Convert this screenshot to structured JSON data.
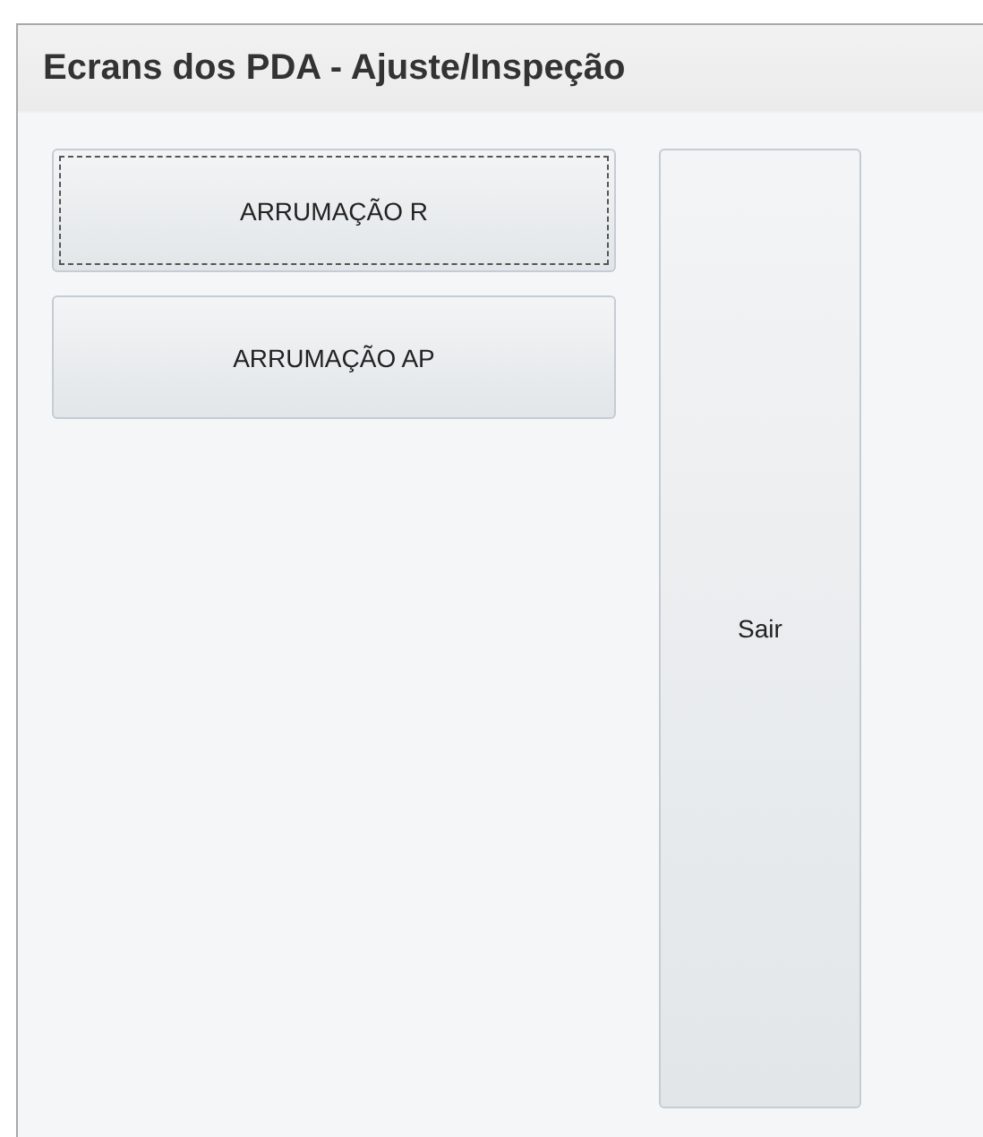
{
  "panel": {
    "title": "Ecrans dos PDA - Ajuste/Inspeção"
  },
  "buttons": [
    {
      "label": "ARRUMAÇÃO R",
      "focused": true,
      "kind": "wide"
    },
    {
      "label": "ARRUMAÇÃO AP",
      "focused": false,
      "kind": "wide"
    },
    {
      "label": "Sair",
      "focused": false,
      "kind": "tall"
    }
  ]
}
